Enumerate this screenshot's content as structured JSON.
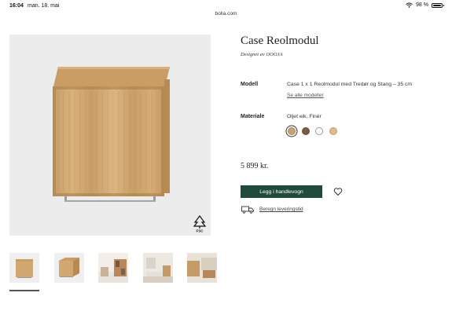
{
  "status_bar": {
    "time": "16:04",
    "date": "man. 18. mai",
    "url": "bolia.com",
    "battery": "98 %",
    "battery_level": 0.98
  },
  "product": {
    "title": "Case Reolmodul",
    "designer": "Designet av OOOJA",
    "price": "5 899 kr."
  },
  "specs": {
    "model_label": "Modell",
    "model_value": "Case 1 x 1 Reolmodul med Tredør og Stang – 35 cm",
    "model_link": "Se alle modeller",
    "material_label": "Materiale",
    "material_value": "Oljet eik, Finér",
    "swatches": [
      {
        "name": "oiled-oak",
        "color": "#c8a275",
        "selected": true
      },
      {
        "name": "dark-oak",
        "color": "#7b5a45",
        "selected": false
      },
      {
        "name": "white",
        "color": "#ffffff",
        "selected": false
      },
      {
        "name": "light-oak",
        "color": "#dcbc8c",
        "selected": false
      }
    ]
  },
  "actions": {
    "add_to_cart": "Legg i handlevogn",
    "shipping_link": "Beregn leveringstid"
  },
  "gallery": {
    "selected_index": 0,
    "thumbnails": [
      "cabinet-front",
      "cabinet-angle",
      "room-shelf",
      "living-room",
      "room-detail"
    ]
  },
  "colors": {
    "accent": "#1f4b3c",
    "hero_bg": "#ececec"
  }
}
